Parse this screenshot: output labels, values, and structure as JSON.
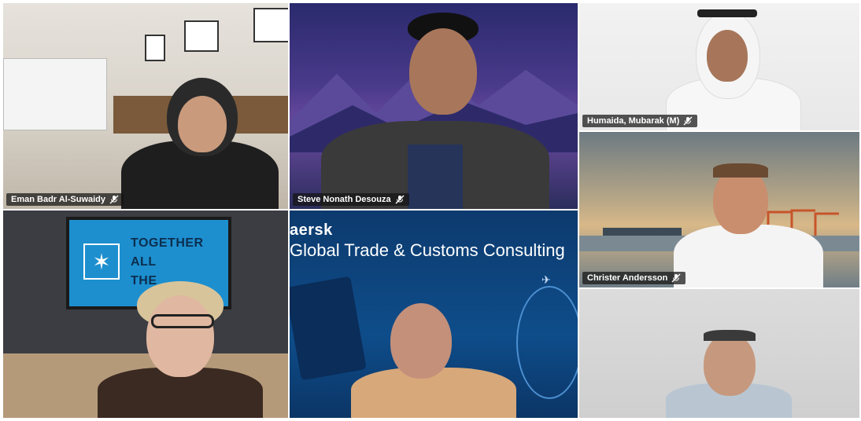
{
  "participants": [
    {
      "name": "Eman Badr Al-Suwaidy"
    },
    {
      "name": "Steve Nonath Desouza"
    },
    {
      "name": "Humaida, Mubarak (M)"
    },
    {
      "name": "Christer Andersson"
    }
  ],
  "background_banner": {
    "brand": "aersk",
    "title": "Global Trade & Customs Consulting"
  },
  "screen_slide": {
    "lines": [
      "TOGETHER",
      "ALL",
      "THE"
    ]
  },
  "icons": {
    "muted_mic": "mic-off-icon"
  },
  "colors": {
    "label_bg": "#141414",
    "maersk_blue": "#0e4d8a"
  }
}
